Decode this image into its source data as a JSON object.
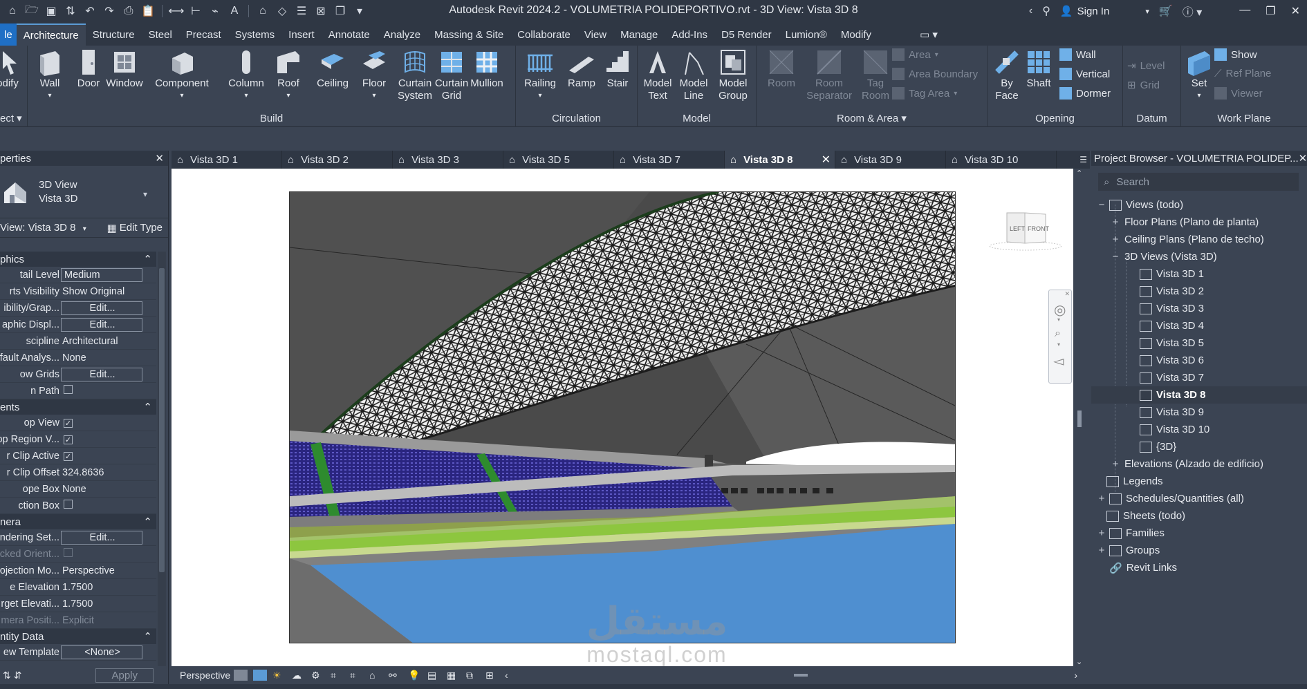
{
  "window": {
    "title": "Autodesk Revit 2024.2 - VOLUMETRIA POLIDEPORTIVO.rvt - 3D View: Vista 3D 8",
    "sign_in": "Sign In"
  },
  "ribbon_tabs": [
    "le",
    "Architecture",
    "Structure",
    "Steel",
    "Precast",
    "Systems",
    "Insert",
    "Annotate",
    "Analyze",
    "Massing & Site",
    "Collaborate",
    "View",
    "Manage",
    "Add-Ins",
    "D5 Render",
    "Lumion®",
    "Modify"
  ],
  "ribbon": {
    "modify_label": "odify",
    "select_label": "ect",
    "build": {
      "label": "Build",
      "tools": [
        "Wall",
        "Door",
        "Window",
        "Component",
        "Column",
        "Roof",
        "Ceiling",
        "Floor",
        "Curtain\nSystem",
        "Curtain\nGrid",
        "Mullion"
      ]
    },
    "circulation": {
      "label": "Circulation",
      "tools": [
        "Railing",
        "Ramp",
        "Stair"
      ]
    },
    "model": {
      "label": "Model",
      "tools": [
        "Model\nText",
        "Model\nLine",
        "Model\nGroup"
      ]
    },
    "room_area": {
      "label": "Room & Area",
      "tools": [
        "Room",
        "Room\nSeparator",
        "Tag\nRoom"
      ],
      "small": [
        "Area",
        "Area  Boundary",
        "Tag  Area"
      ]
    },
    "opening": {
      "label": "Opening",
      "tools": [
        "By\nFace",
        "Shaft"
      ],
      "small": [
        "Wall",
        "Vertical",
        "Dormer"
      ]
    },
    "datum": {
      "label": "Datum",
      "small": [
        "Level",
        "Grid"
      ]
    },
    "work_plane": {
      "label": "Work Plane",
      "tools": [
        "Set"
      ],
      "small": [
        "Show",
        "Ref  Plane",
        "Viewer"
      ]
    }
  },
  "properties": {
    "title": "perties",
    "type_line1": "3D View",
    "type_line2": "Vista 3D",
    "view_selector": "View: Vista 3D 8",
    "edit_type": "Edit Type",
    "sections": {
      "graphics": "phics",
      "extents": "ents",
      "camera": "nera",
      "identity": "ntity Data"
    },
    "rows": {
      "detail_level": {
        "k": "tail Level",
        "v": "Medium"
      },
      "parts_visibility": {
        "k": "rts Visibility",
        "v": "Show Original"
      },
      "vis_graphics": {
        "k": "ibility/Grap...",
        "v": "Edit..."
      },
      "graphic_display": {
        "k": "aphic Displ...",
        "v": "Edit..."
      },
      "discipline": {
        "k": "scipline",
        "v": "Architectural"
      },
      "default_analysis": {
        "k": "fault Analys...",
        "v": "None"
      },
      "show_grids": {
        "k": "ow Grids",
        "v": "Edit..."
      },
      "sun_path": {
        "k": "n Path"
      },
      "crop_view": {
        "k": "op View"
      },
      "crop_region": {
        "k": "op Region V..."
      },
      "far_clip": {
        "k": "r Clip Active"
      },
      "far_clip_offset": {
        "k": "r Clip Offset",
        "v": "324.8636"
      },
      "scope_box": {
        "k": "ope Box",
        "v": "None"
      },
      "section_box": {
        "k": "ction Box"
      },
      "rendering": {
        "k": "ndering Set...",
        "v": "Edit..."
      },
      "locked": {
        "k": "cked Orient..."
      },
      "projection": {
        "k": "ojection Mo...",
        "v": "Perspective"
      },
      "eye_elev": {
        "k": "e Elevation",
        "v": "1.7500"
      },
      "target_elev": {
        "k": "rget Elevati...",
        "v": "1.7500"
      },
      "camera_pos": {
        "k": "mera Positi...",
        "v": "Explicit"
      },
      "view_template": {
        "k": "ew Template",
        "v": "<None>"
      }
    },
    "apply": "Apply"
  },
  "view_tabs": [
    "Vista 3D 1",
    "Vista 3D 2",
    "Vista 3D 3",
    "Vista 3D 5",
    "Vista 3D 7",
    "Vista 3D 8",
    "Vista 3D 9",
    "Vista 3D 10"
  ],
  "viewcube": {
    "left": "LEFT",
    "front": "FRONT"
  },
  "view_control": {
    "projection": "Perspective"
  },
  "browser": {
    "title": "Project Browser - VOLUMETRIA POLIDEP...",
    "search_placeholder": "Search",
    "views_root": "Views (todo)",
    "floor_plans": "Floor Plans (Plano de planta)",
    "ceiling_plans": "Ceiling Plans (Plano de techo)",
    "views_3d": "3D Views (Vista 3D)",
    "items_3d": [
      "Vista 3D 1",
      "Vista 3D 2",
      "Vista 3D 3",
      "Vista 3D 4",
      "Vista 3D 5",
      "Vista 3D 6",
      "Vista 3D 7",
      "Vista 3D 8",
      "Vista 3D 9",
      "Vista 3D 10",
      "{3D}"
    ],
    "elevations": "Elevations (Alzado de edificio)",
    "legends": "Legends",
    "schedules": "Schedules/Quantities (all)",
    "sheets": "Sheets (todo)",
    "families": "Families",
    "groups": "Groups",
    "revit_links": "Revit Links"
  },
  "watermark": {
    "arabic": "مستقل",
    "latin": "mostaql.com"
  },
  "colors": {
    "ui_bg": "#3b4453",
    "ui_dark": "#2f3744",
    "accent": "#5b9bd5",
    "pool": "#4f8fd0",
    "turf": "#8dc63f",
    "seats": "#2f2a8a"
  }
}
